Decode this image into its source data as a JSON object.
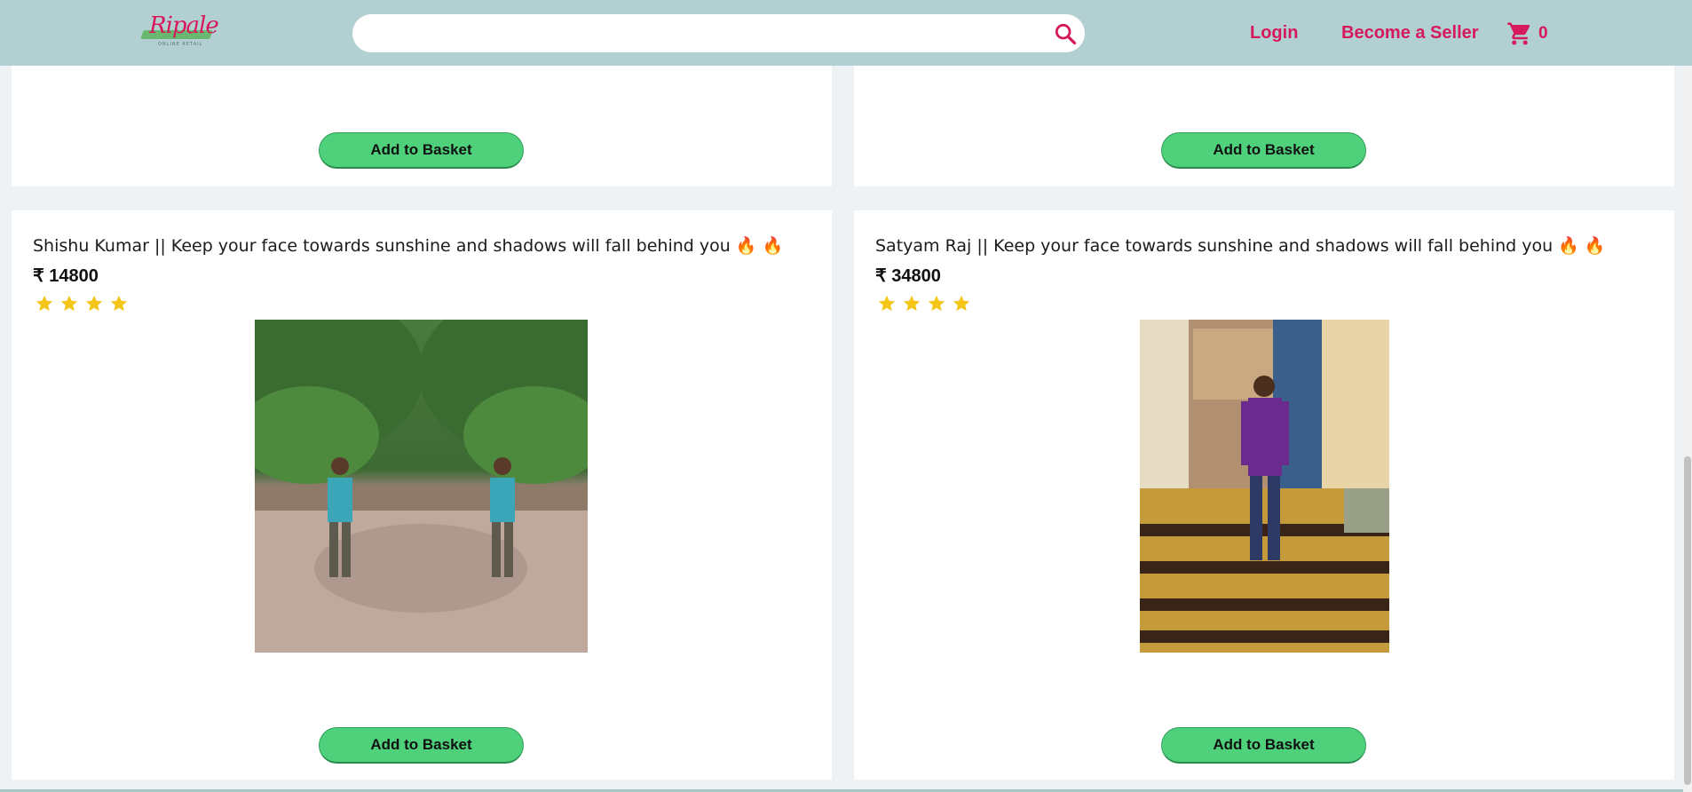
{
  "header": {
    "logo_text": "Ripale",
    "logo_subtitle": "ONLINE RETAIL",
    "search_placeholder": "",
    "login_label": "Login",
    "seller_label": "Become a Seller",
    "cart_count": "0",
    "background_color": "#b2d0d2",
    "accent_color": "#d6195c"
  },
  "top_cards": [
    {
      "button_label": "Add to Basket"
    },
    {
      "button_label": "Add to Basket"
    }
  ],
  "products": [
    {
      "title": "Shishu Kumar || Keep your face towards sunshine and shadows will fall behind you",
      "title_emoji": "🔥 🔥",
      "price": "₹ 14800",
      "rating": 4,
      "image_description_icon": "photo-two-boys-trees",
      "button_label": "Add to Basket"
    },
    {
      "title": "Satyam Raj || Keep your face towards sunshine and shadows will fall behind you",
      "title_emoji": "🔥 🔥",
      "price": "₹ 34800",
      "rating": 4,
      "image_description_icon": "photo-man-purple-shirt",
      "button_label": "Add to Basket"
    }
  ],
  "button_color": "#4fd17b",
  "star_color": "#f5c518"
}
